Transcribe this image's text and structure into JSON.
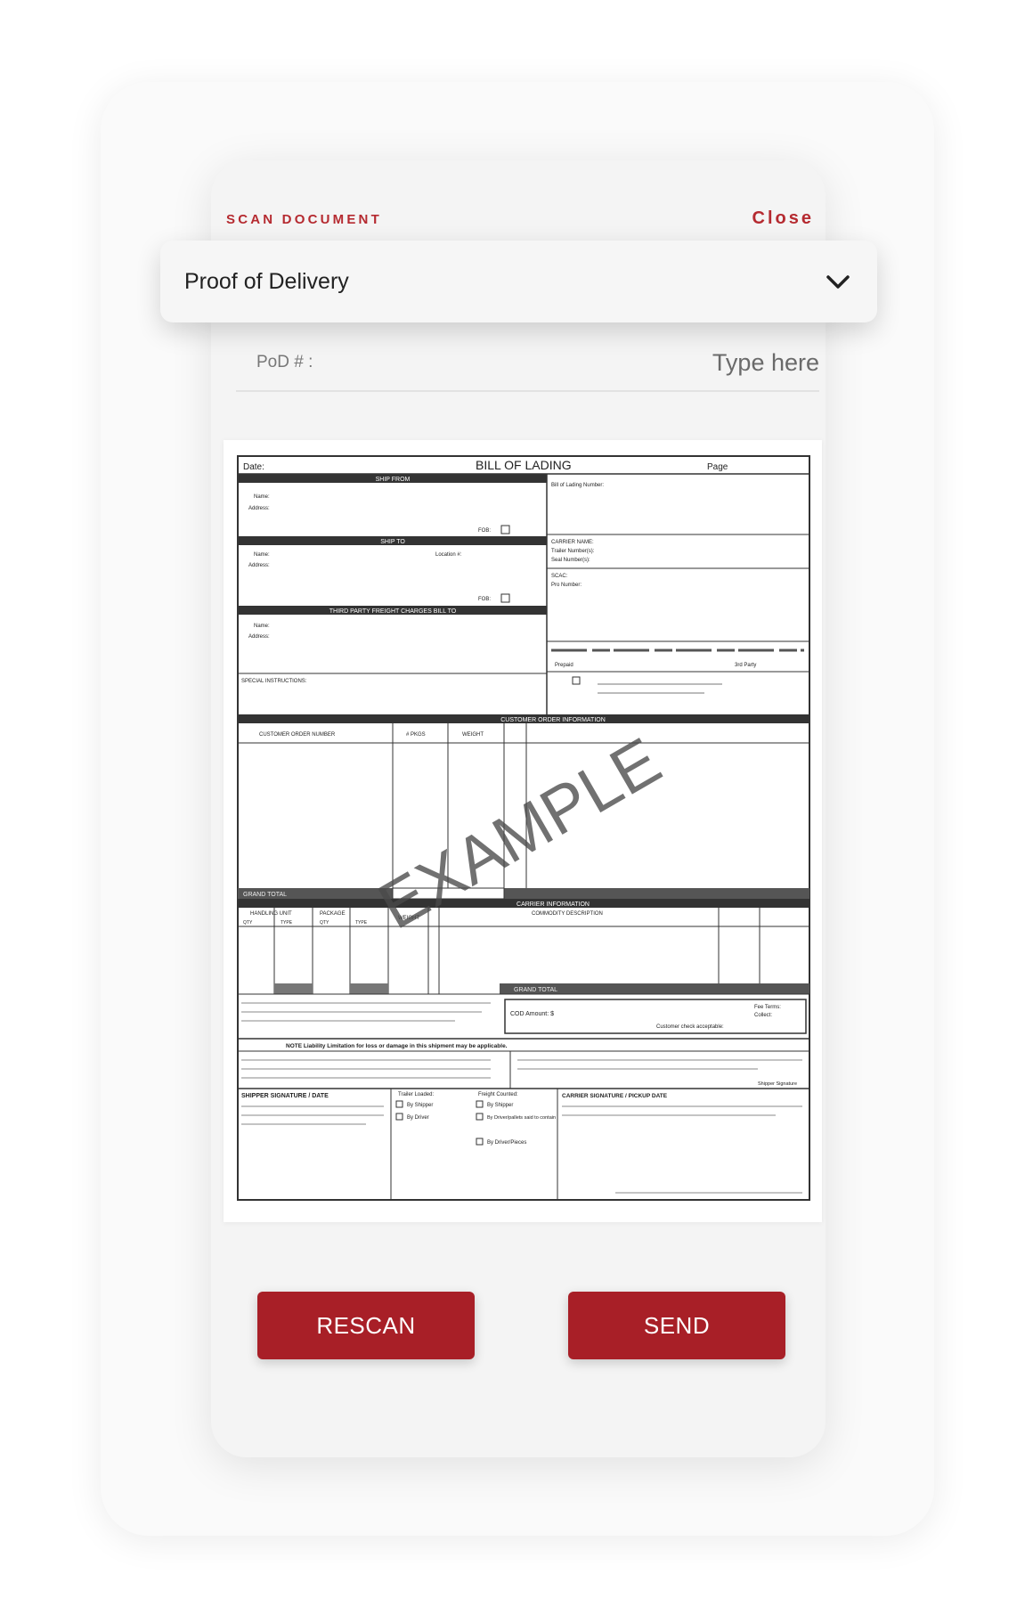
{
  "header": {
    "title": "SCAN DOCUMENT",
    "close_label": "Close"
  },
  "document_type": {
    "selected": "Proof of Delivery"
  },
  "pod_field": {
    "label": "PoD # :",
    "placeholder": "Type here"
  },
  "scan_preview": {
    "form_title": "BILL OF LADING",
    "date_label": "Date:",
    "page_label": "Page",
    "ship_from_header": "SHIP FROM",
    "ship_to_header": "SHIP TO",
    "third_party_header": "THIRD PARTY FREIGHT CHARGES BILL TO",
    "special_instructions_label": "SPECIAL INSTRUCTIONS:",
    "bol_number_label": "Bill of Lading Number:",
    "carrier_name_label": "CARRIER NAME:",
    "trailer_number_label": "Trailer Number(s):",
    "seal_number_label": "Seal Number(s):",
    "scac_label": "SCAC:",
    "pro_number_label": "Pro Number:",
    "name_label": "Name:",
    "address_label": "Address:",
    "location_label": "Location #:",
    "fob_label": "FOB:",
    "prepaid_label": "Prepaid",
    "third_party_label": "3rd Party",
    "customer_order_header": "CUSTOMER ORDER INFORMATION",
    "customer_order_number_label": "CUSTOMER ORDER NUMBER",
    "pkgs_label": "# PKGS",
    "weight_label": "WEIGHT",
    "grand_total_label": "GRAND TOTAL",
    "carrier_info_header": "CARRIER INFORMATION",
    "handling_unit_label": "HANDLING UNIT",
    "package_label": "PACKAGE",
    "qty_label": "QTY",
    "type_label": "TYPE",
    "commodity_label": "COMMODITY DESCRIPTION",
    "cod_label": "COD Amount: $",
    "fee_terms_label": "Fee Terms:",
    "collect_label": "Collect:",
    "customer_check_label": "Customer check acceptable:",
    "liability_note": "NOTE Liability Limitation for loss or damage in this shipment may be applicable.",
    "shipper_signature_label": "SHIPPER SIGNATURE / DATE",
    "trailer_loaded_label": "Trailer Loaded:",
    "freight_counted_label": "Freight Counted:",
    "by_shipper_label": "By Shipper",
    "by_driver_label": "By Driver",
    "by_driver_pallets_label": "By Driver/pallets said to contain",
    "by_driver_pieces_label": "By Driver/Pieces",
    "carrier_signature_label": "CARRIER SIGNATURE / PICKUP DATE",
    "shipper_signature_small": "Shipper Signature",
    "watermark": "EXAMPLE"
  },
  "actions": {
    "rescan_label": "RESCAN",
    "send_label": "SEND"
  },
  "colors": {
    "accent": "#a81f27",
    "header_red": "#b52a30"
  }
}
